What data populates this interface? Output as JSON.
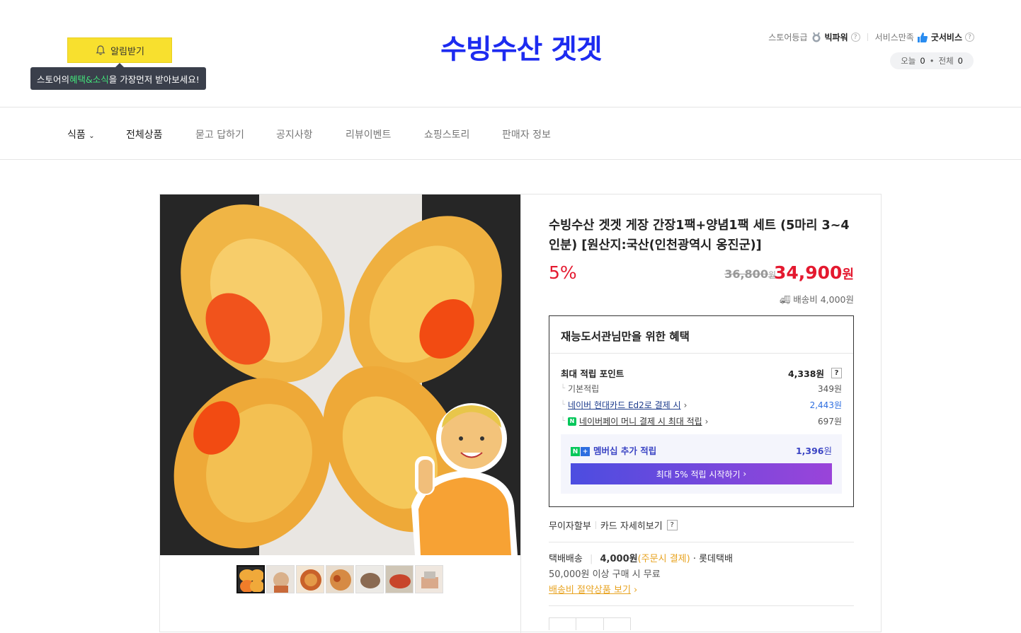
{
  "header": {
    "alarm_label": "알림받기",
    "tooltip_pre": "스토어의 ",
    "tooltip_hl": "혜택&소식",
    "tooltip_post": "을 가장먼저 받아보세요!",
    "logo_text": "수빙수산 겟겟",
    "grade_label": "스토어등급",
    "grade_value": "빅파워",
    "service_label": "서비스만족",
    "service_value": "굿서비스",
    "visit_today_label": "오늘",
    "visit_today": "0",
    "visit_total_label": "전체",
    "visit_total": "0"
  },
  "nav": {
    "items": [
      "식품",
      "전체상품",
      "묻고 답하기",
      "공지사항",
      "리뷰이벤트",
      "쇼핑스토리",
      "판매자 정보"
    ]
  },
  "product": {
    "title": "수빙수산 겟겟 게장 간장1팩+양념1팩 세트 (5마리 3~4인분) [원산지:국산(인천광역시 옹진군)]",
    "discount": "5%",
    "orig_price": "36,800",
    "orig_unit": "원",
    "sale_price": "34,900",
    "sale_unit": "원",
    "shipping": "배송비 4,000원"
  },
  "benefit": {
    "title": "재능도서관님만을 위한 혜택",
    "max_point_label": "최대 적립 포인트",
    "max_point_value": "4,338원",
    "rows": [
      {
        "label": "기본적립",
        "value": "349원"
      },
      {
        "label": "네이버 현대카드 Ed2로 결제 시",
        "value": "2,443원"
      },
      {
        "label": "네이버페이 머니 결제 시 최대 적립",
        "value": "697원"
      }
    ],
    "member_label": "멤버십 추가 적립",
    "member_value": "1,396",
    "member_unit": "원",
    "member_btn": "최대 5% 적립 시작하기"
  },
  "payment": {
    "installment": "무이자할부",
    "card_detail": "카드 자세히보기"
  },
  "delivery": {
    "method": "택배배송",
    "fee": "4,000원",
    "fee_note": "(주문시 결제)",
    "carrier": "· 롯데택배",
    "free_cond": "50,000원 이상 구매 시 무료",
    "saving_link": "배송비 절약상품 보기"
  },
  "colors": {
    "accent_red": "#e4192f",
    "alarm_yellow": "#f8e02e",
    "logo_blue": "#1d2bf0",
    "naver_green": "#03c75a"
  }
}
